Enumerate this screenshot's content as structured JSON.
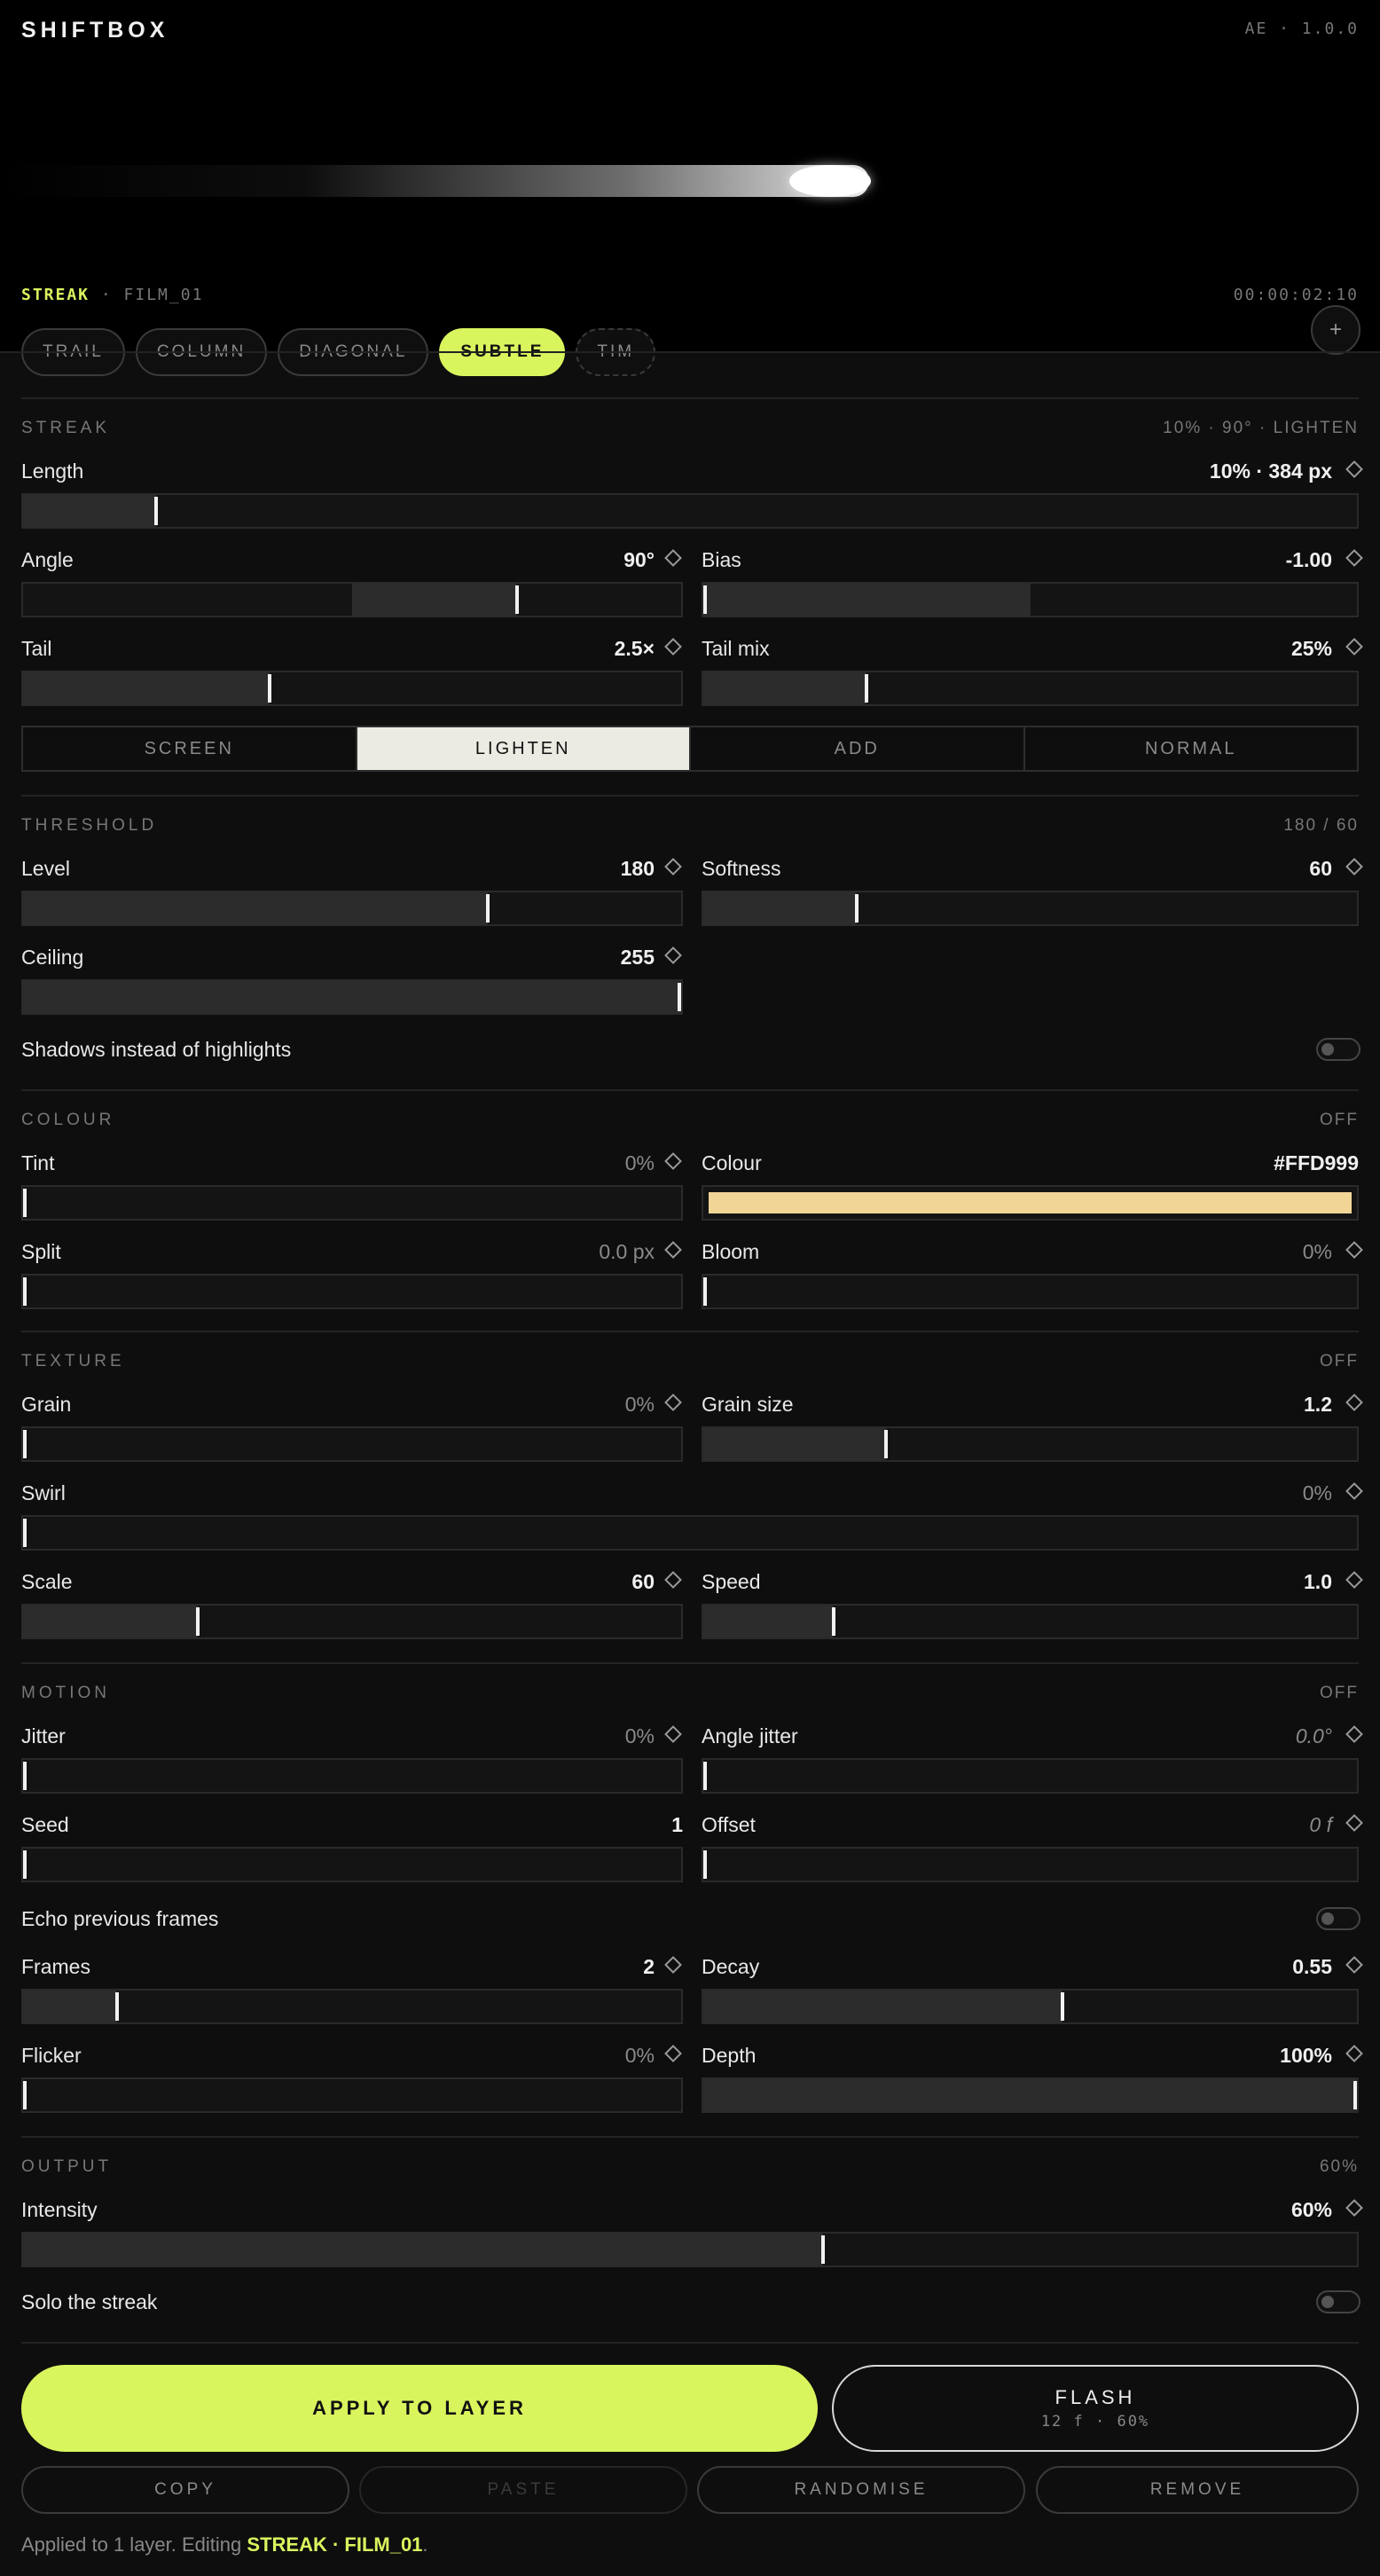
{
  "app": {
    "name": "SHIFTBOX",
    "version": "AE · 1.0.0"
  },
  "preview": {
    "preset_name": "STREAK",
    "preset_sep": " · FILM_01",
    "timecode": "00:00:02:10"
  },
  "presets": [
    {
      "label": "TRAIL"
    },
    {
      "label": "COLUMN"
    },
    {
      "label": "DIAGONAL"
    },
    {
      "label": "SUBTLE"
    },
    {
      "label": "TIM"
    }
  ],
  "add_label": "+",
  "streak": {
    "title": "STREAK",
    "meta": "10% · 90° · LIGHTEN",
    "length": {
      "label": "Length",
      "value": "10% · 384 px",
      "level": 0.1
    },
    "angle": {
      "label": "Angle",
      "value": "90°",
      "level": 0.75
    },
    "bias": {
      "label": "Bias",
      "value": "-1.00",
      "level": 0.0
    },
    "tail": {
      "label": "Tail",
      "value": "2.5×",
      "level": 0.375
    },
    "tail_mix": {
      "label": "Tail mix",
      "value": "25%",
      "level": 0.25
    },
    "blend_modes": [
      "SCREEN",
      "LIGHTEN",
      "ADD",
      "NORMAL"
    ],
    "blend_selected": "LIGHTEN"
  },
  "threshold": {
    "title": "THRESHOLD",
    "meta": "180 / 60",
    "level": {
      "label": "Level",
      "value": "180",
      "level": 0.706
    },
    "softness": {
      "label": "Softness",
      "value": "60",
      "level": 0.235
    },
    "ceiling": {
      "label": "Ceiling",
      "value": "255",
      "level": 1.0
    },
    "shadows": {
      "label": "Shadows instead of highlights"
    }
  },
  "colour": {
    "title": "COLOUR",
    "meta": "OFF",
    "tint": {
      "label": "Tint",
      "value": "0%",
      "level": 0
    },
    "colour": {
      "label": "Colour",
      "value": "#FFD999",
      "swatch": "#f1d597"
    },
    "split": {
      "label": "Split",
      "value": "0.0 px",
      "level": 0
    },
    "bloom": {
      "label": "Bloom",
      "value": "0%",
      "level": 0
    }
  },
  "texture": {
    "title": "TEXTURE",
    "meta": "OFF",
    "grain": {
      "label": "Grain",
      "value": "0%",
      "level": 0
    },
    "grain_size": {
      "label": "Grain size",
      "value": "1.2",
      "level": 0.28
    },
    "swirl": {
      "label": "Swirl",
      "value": "0%",
      "level": 0
    },
    "scale": {
      "label": "Scale",
      "value": "60",
      "level": 0.265
    },
    "speed": {
      "label": "Speed",
      "value": "1.0",
      "level": 0.2
    }
  },
  "motion": {
    "title": "MOTION",
    "meta": "OFF",
    "jitter": {
      "label": "Jitter",
      "value": "0%",
      "level": 0
    },
    "angle_jitter": {
      "label": "Angle jitter",
      "value": "0.0°",
      "level": 0
    },
    "seed": {
      "label": "Seed",
      "value": "1",
      "level": 0
    },
    "offset": {
      "label": "Offset",
      "value": "0 f",
      "level": 0
    },
    "echo": {
      "label": "Echo previous frames"
    },
    "frames": {
      "label": "Frames",
      "value": "2",
      "level": 0.143
    },
    "decay": {
      "label": "Decay",
      "value": "0.55",
      "level": 0.55
    },
    "flicker": {
      "label": "Flicker",
      "value": "0%",
      "level": 0
    },
    "depth": {
      "label": "Depth",
      "value": "100%",
      "level": 1.0
    }
  },
  "output": {
    "title": "OUTPUT",
    "meta": "60%",
    "intensity": {
      "label": "Intensity",
      "value": "60%",
      "level": 0.6
    },
    "solo": {
      "label": "Solo the streak"
    }
  },
  "actions": {
    "apply": "APPLY TO LAYER",
    "flash": "FLASH",
    "flash_sub": "12 f · 60%",
    "copy": "COPY",
    "paste": "PASTE",
    "randomise": "RANDOMISE",
    "remove": "REMOVE"
  },
  "status": {
    "prefix": "Applied to 1 layer. Editing ",
    "target": "STREAK · FILM_01",
    "suffix": "."
  },
  "colors": {
    "accent": "#d9f55e",
    "background": "#0e0e0e"
  }
}
